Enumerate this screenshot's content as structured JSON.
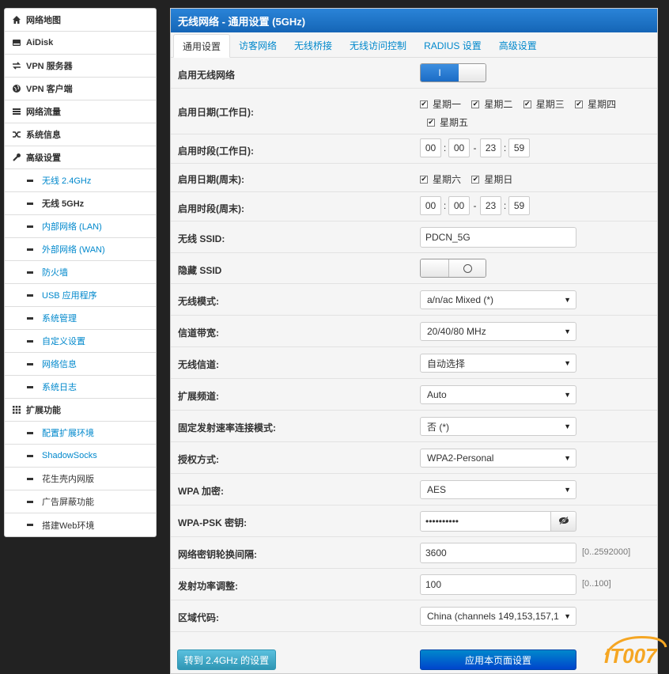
{
  "sidebar": {
    "items": [
      {
        "label": "网络地图",
        "icon": "home-icon"
      },
      {
        "label": "AiDisk",
        "icon": "disk-icon"
      },
      {
        "label": "VPN 服务器",
        "icon": "shuffle-arrows-icon"
      },
      {
        "label": "VPN 客户端",
        "icon": "globe-icon"
      },
      {
        "label": "网络流量",
        "icon": "list-icon"
      },
      {
        "label": "系统信息",
        "icon": "random-icon"
      },
      {
        "label": "高级设置",
        "icon": "wrench-icon"
      }
    ],
    "advanced_sub": [
      "无线 2.4GHz",
      "无线 5GHz",
      "内部网络 (LAN)",
      "外部网络 (WAN)",
      "防火墙",
      "USB 应用程序",
      "系统管理",
      "自定义设置",
      "网络信息",
      "系统日志"
    ],
    "extension": {
      "label": "扩展功能",
      "icon": "grid-icon"
    },
    "extension_sub": [
      "配置扩展环境",
      "ShadowSocks",
      "花生壳内网版",
      "广告屏蔽功能",
      "搭建Web环境"
    ]
  },
  "panel": {
    "title": "无线网络 - 通用设置 (5GHz)",
    "tabs": [
      "通用设置",
      "访客网络",
      "无线桥接",
      "无线访问控制",
      "RADIUS 设置",
      "高级设置"
    ]
  },
  "form": {
    "enable_wireless": {
      "label": "启用无线网络",
      "toggle_on": "I"
    },
    "weekday_days": {
      "label": "启用日期(工作日):",
      "days": [
        "星期一",
        "星期二",
        "星期三",
        "星期四",
        "星期五"
      ]
    },
    "weekday_time": {
      "label": "启用时段(工作日):",
      "h1": "00",
      "m1": "00",
      "h2": "23",
      "m2": "59"
    },
    "weekend_days": {
      "label": "启用日期(周末):",
      "days": [
        "星期六",
        "星期日"
      ]
    },
    "weekend_time": {
      "label": "启用时段(周末):",
      "h1": "00",
      "m1": "00",
      "h2": "23",
      "m2": "59"
    },
    "ssid": {
      "label": "无线 SSID:",
      "value": "PDCN_5G"
    },
    "hide_ssid": {
      "label": "隐藏 SSID"
    },
    "mode": {
      "label": "无线模式:",
      "value": "a/n/ac Mixed (*)"
    },
    "bandwidth": {
      "label": "信道带宽:",
      "value": "20/40/80 MHz"
    },
    "channel": {
      "label": "无线信道:",
      "value": "自动选择"
    },
    "ext_channel": {
      "label": "扩展频道:",
      "value": "Auto"
    },
    "fixed_rate": {
      "label": "固定发射速率连接模式:",
      "value": "否 (*)"
    },
    "auth": {
      "label": "授权方式:",
      "value": "WPA2-Personal"
    },
    "wpa_enc": {
      "label": "WPA 加密:",
      "value": "AES"
    },
    "psk": {
      "label": "WPA-PSK 密钥:",
      "value": "••••••••••"
    },
    "rotation": {
      "label": "网络密钥轮换间隔:",
      "value": "3600",
      "hint": "[0..2592000]"
    },
    "txpower": {
      "label": "发射功率调整:",
      "value": "100",
      "hint": "[0..100]"
    },
    "region": {
      "label": "区域代码:",
      "value": "China (channels 149,153,157,1"
    }
  },
  "buttons": {
    "goto_24": "转到 2.4GHz 的设置",
    "apply": "应用本页面设置"
  },
  "watermark": "IT007"
}
